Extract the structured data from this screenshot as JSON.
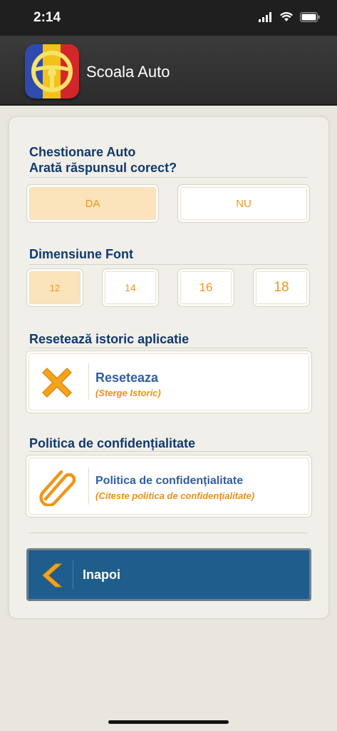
{
  "status_bar": {
    "time": "2:14"
  },
  "header": {
    "title": "Scoala Auto"
  },
  "quiz_section": {
    "title_line1": "Chestionare Auto",
    "title_line2": "Arată răspunsul corect?",
    "options": [
      {
        "label": "DA",
        "selected": true
      },
      {
        "label": "NU",
        "selected": false
      }
    ]
  },
  "font_section": {
    "title": "Dimensiune Font",
    "sizes": [
      {
        "label": "12",
        "selected": true
      },
      {
        "label": "14",
        "selected": false
      },
      {
        "label": "16",
        "selected": false
      },
      {
        "label": "18",
        "selected": false
      }
    ]
  },
  "reset_section": {
    "title": "Resetează istoric aplicatie",
    "card_title": "Reseteaza",
    "card_subtitle": "(Sterge Istoric)",
    "icon": "close-icon"
  },
  "privacy_section": {
    "title": "Politica de confidențialitate",
    "card_title": "Politica de confidențialitate",
    "card_subtitle": "(Citeste politica de confidențialitate)",
    "icon": "paperclip-icon"
  },
  "back_button": {
    "label": "Inapoi",
    "icon": "chevron-left-icon"
  },
  "colors": {
    "accent_orange": "#f0961a",
    "title_blue": "#103a6e",
    "link_blue": "#2f5ea0",
    "button_blue": "#1f5d8c",
    "selected_bg": "#fbe3bb"
  }
}
